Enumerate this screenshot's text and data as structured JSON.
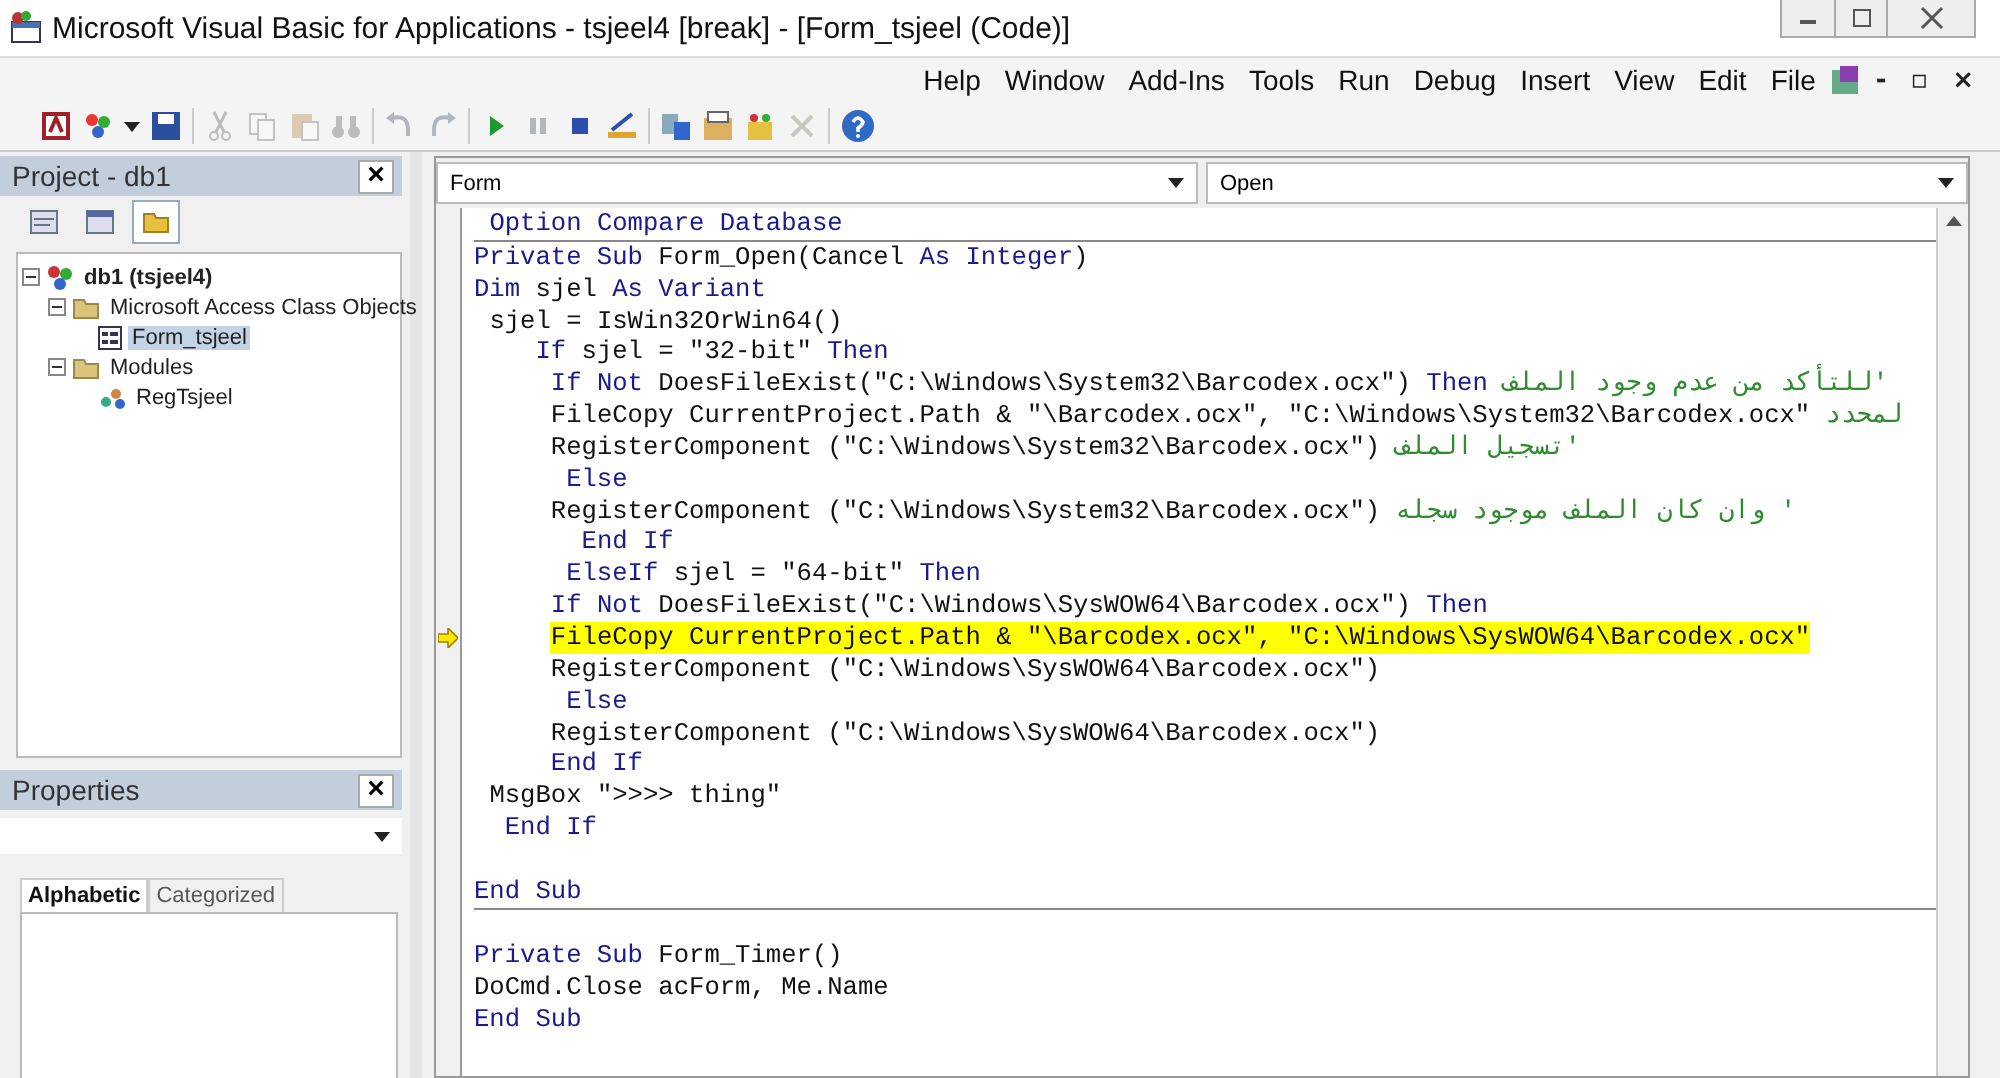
{
  "window": {
    "title": "Microsoft Visual Basic for Applications - tsjeel4 [break] - [Form_tsjeel (Code)]"
  },
  "menu": [
    "Help",
    "Window",
    "Add-Ins",
    "Tools",
    "Run",
    "Debug",
    "Insert",
    "View",
    "Edit",
    "File"
  ],
  "mdi_controls": [
    "-",
    "▫",
    "×"
  ],
  "toolbar": [
    {
      "kind": "access",
      "disabled": false
    },
    {
      "kind": "insert",
      "disabled": false
    },
    {
      "kind": "caret",
      "disabled": false
    },
    {
      "kind": "save",
      "disabled": false
    },
    {
      "kind": "separator"
    },
    {
      "kind": "cut",
      "disabled": true
    },
    {
      "kind": "copy",
      "disabled": true
    },
    {
      "kind": "paste",
      "disabled": true
    },
    {
      "kind": "find",
      "disabled": true
    },
    {
      "kind": "separator"
    },
    {
      "kind": "undo",
      "disabled": true
    },
    {
      "kind": "redo",
      "disabled": true
    },
    {
      "kind": "separator"
    },
    {
      "kind": "run",
      "disabled": false
    },
    {
      "kind": "pause",
      "disabled": true
    },
    {
      "kind": "stop",
      "disabled": false
    },
    {
      "kind": "design",
      "disabled": false
    },
    {
      "kind": "separator"
    },
    {
      "kind": "explorer",
      "disabled": false
    },
    {
      "kind": "properties",
      "disabled": false
    },
    {
      "kind": "browser",
      "disabled": false
    },
    {
      "kind": "toolbox",
      "disabled": true
    },
    {
      "kind": "separator"
    },
    {
      "kind": "help",
      "disabled": false
    }
  ],
  "project": {
    "title": "Project - db1",
    "close": "×",
    "buttons": [
      {
        "kind": "code",
        "selected": false
      },
      {
        "kind": "object",
        "selected": false
      },
      {
        "kind": "folders",
        "selected": true
      }
    ],
    "tree": [
      {
        "label": "db1 (tsjeel4)",
        "kind": "project",
        "expanded": true,
        "selected": false,
        "children": [
          {
            "label": "Microsoft Access Class Objects",
            "kind": "folder",
            "expanded": true,
            "selected": false,
            "children": [
              {
                "label": "Form_tsjeel",
                "kind": "form",
                "selected": true
              }
            ]
          },
          {
            "label": "Modules",
            "kind": "folder",
            "expanded": true,
            "selected": false,
            "children": [
              {
                "label": "RegTsjeel",
                "kind": "module",
                "selected": false
              }
            ]
          }
        ]
      }
    ]
  },
  "properties": {
    "title": "Properties",
    "close": "×",
    "tabs": [
      {
        "label": "Alphabetic",
        "selected": true
      },
      {
        "label": "Categorized",
        "selected": false
      }
    ]
  },
  "code": {
    "object": "Form",
    "procedure": "Open",
    "sections": [
      {
        "lines": [
          {
            "kind": "code",
            "highlighted": false,
            "current": false,
            "segments": [
              {
                "kind": "keyword",
                "text": " Option Compare Database"
              }
            ]
          }
        ]
      },
      {
        "lines": [
          {
            "kind": "code",
            "highlighted": false,
            "current": false,
            "segments": [
              {
                "kind": "keyword",
                "text": "Private Sub "
              },
              {
                "kind": "plain",
                "text": "Form_Open(Cancel "
              },
              {
                "kind": "keyword",
                "text": "As Integer"
              },
              {
                "kind": "plain",
                "text": ")"
              }
            ]
          },
          {
            "kind": "code",
            "highlighted": false,
            "current": false,
            "segments": [
              {
                "kind": "keyword",
                "text": "Dim "
              },
              {
                "kind": "plain",
                "text": "sjel "
              },
              {
                "kind": "keyword",
                "text": "As Variant"
              }
            ]
          },
          {
            "kind": "code",
            "highlighted": false,
            "current": false,
            "segments": [
              {
                "kind": "plain",
                "text": " sjel = IsWin32OrWin64()"
              }
            ]
          },
          {
            "kind": "code",
            "highlighted": false,
            "current": false,
            "segments": [
              {
                "kind": "keyword",
                "text": "    If "
              },
              {
                "kind": "plain",
                "text": "sjel = \"32-bit\" "
              },
              {
                "kind": "keyword",
                "text": "Then"
              }
            ]
          },
          {
            "kind": "code",
            "highlighted": false,
            "current": false,
            "segments": [
              {
                "kind": "keyword",
                "text": "     If Not "
              },
              {
                "kind": "plain",
                "text": "DoesFileExist(\"C:\\Windows\\System32\\Barcodex.ocx\") "
              },
              {
                "kind": "keyword",
                "text": "Then "
              },
              {
                "kind": "comment",
                "text": "'للتأكد من عدم وجود الملف"
              }
            ]
          },
          {
            "kind": "code",
            "highlighted": false,
            "current": false,
            "segments": [
              {
                "kind": "plain",
                "text": "     FileCopy CurrentProject.Path & \"\\Barcodex.ocx\", \"C:\\Windows\\System32\\Barcodex.ocx\" "
              },
              {
                "kind": "comment",
                "text": "لمحدد"
              }
            ]
          },
          {
            "kind": "code",
            "highlighted": false,
            "current": false,
            "segments": [
              {
                "kind": "plain",
                "text": "     RegisterComponent (\"C:\\Windows\\System32\\Barcodex.ocx\") "
              },
              {
                "kind": "comment",
                "text": "'تسجيل الملف"
              }
            ]
          },
          {
            "kind": "code",
            "highlighted": false,
            "current": false,
            "segments": [
              {
                "kind": "keyword",
                "text": "      Else"
              }
            ]
          },
          {
            "kind": "code",
            "highlighted": false,
            "current": false,
            "segments": [
              {
                "kind": "plain",
                "text": "     RegisterComponent (\"C:\\Windows\\System32\\Barcodex.ocx\") "
              },
              {
                "kind": "comment",
                "text": "' وان كان الملف موجود سجله"
              }
            ]
          },
          {
            "kind": "code",
            "highlighted": false,
            "current": false,
            "segments": [
              {
                "kind": "keyword",
                "text": "       End If"
              }
            ]
          },
          {
            "kind": "code",
            "highlighted": false,
            "current": false,
            "segments": [
              {
                "kind": "keyword",
                "text": "      ElseIf "
              },
              {
                "kind": "plain",
                "text": "sjel = \"64-bit\" "
              },
              {
                "kind": "keyword",
                "text": "Then"
              }
            ]
          },
          {
            "kind": "code",
            "highlighted": false,
            "current": false,
            "segments": [
              {
                "kind": "keyword",
                "text": "     If Not "
              },
              {
                "kind": "plain",
                "text": "DoesFileExist(\"C:\\Windows\\SysWOW64\\Barcodex.ocx\") "
              },
              {
                "kind": "keyword",
                "text": "Then"
              }
            ]
          },
          {
            "kind": "code",
            "highlighted": true,
            "current": true,
            "segments": [
              {
                "kind": "plain",
                "text": "     FileCopy CurrentProject.Path & \"\\Barcodex.ocx\", \"C:\\Windows\\SysWOW64\\Barcodex.ocx\""
              }
            ]
          },
          {
            "kind": "code",
            "highlighted": false,
            "current": false,
            "segments": [
              {
                "kind": "plain",
                "text": "     RegisterComponent (\"C:\\Windows\\SysWOW64\\Barcodex.ocx\")"
              }
            ]
          },
          {
            "kind": "code",
            "highlighted": false,
            "current": false,
            "segments": [
              {
                "kind": "keyword",
                "text": "      Else"
              }
            ]
          },
          {
            "kind": "code",
            "highlighted": false,
            "current": false,
            "segments": [
              {
                "kind": "plain",
                "text": "     RegisterComponent (\"C:\\Windows\\SysWOW64\\Barcodex.ocx\")"
              }
            ]
          },
          {
            "kind": "code",
            "highlighted": false,
            "current": false,
            "segments": [
              {
                "kind": "keyword",
                "text": "     End If"
              }
            ]
          },
          {
            "kind": "code",
            "highlighted": false,
            "current": false,
            "segments": [
              {
                "kind": "plain",
                "text": " MsgBox \">>>> thing\""
              }
            ]
          },
          {
            "kind": "code",
            "highlighted": false,
            "current": false,
            "segments": [
              {
                "kind": "keyword",
                "text": "  End If"
              }
            ]
          },
          {
            "kind": "blank"
          },
          {
            "kind": "code",
            "highlighted": false,
            "current": false,
            "segments": [
              {
                "kind": "keyword",
                "text": "End Sub"
              }
            ]
          }
        ]
      },
      {
        "lines": [
          {
            "kind": "blank"
          },
          {
            "kind": "code",
            "highlighted": false,
            "current": false,
            "segments": [
              {
                "kind": "keyword",
                "text": "Private Sub "
              },
              {
                "kind": "plain",
                "text": "Form_Timer()"
              }
            ]
          },
          {
            "kind": "code",
            "highlighted": false,
            "current": false,
            "segments": [
              {
                "kind": "plain",
                "text": "DoCmd.Close acForm, Me.Name"
              }
            ]
          },
          {
            "kind": "code",
            "highlighted": false,
            "current": false,
            "segments": [
              {
                "kind": "keyword",
                "text": "End Sub"
              }
            ]
          }
        ]
      }
    ]
  }
}
